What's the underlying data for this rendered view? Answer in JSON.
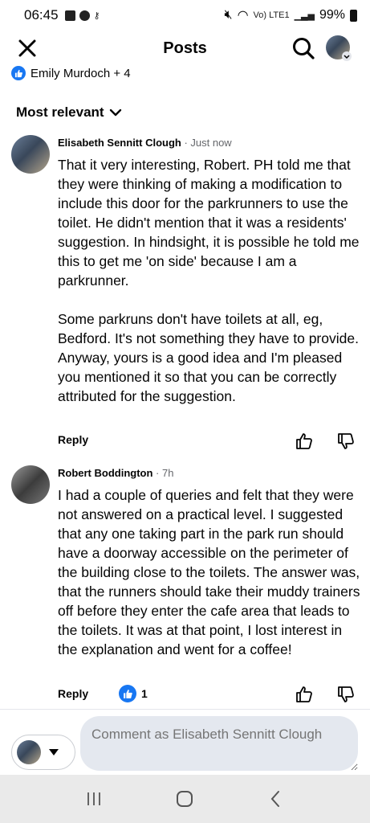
{
  "status_bar": {
    "time": "06:45",
    "net_label": "Vo) LTE1",
    "battery": "99%"
  },
  "header": {
    "title": "Posts"
  },
  "reactors": {
    "text": "Emily Murdoch + 4"
  },
  "sort": {
    "label": "Most relevant"
  },
  "comments": [
    {
      "author": "Elisabeth Sennitt Clough",
      "time": " · Just now",
      "body": "That it very interesting, Robert. PH told me that they were thinking of making a modification to include this door for the parkrunners to use the toilet. He didn't mention that it was a residents' suggestion. In hindsight, it is possible he told me this to get me 'on side' because I am a parkrunner.\n\nSome parkruns don't have toilets at all, eg, Bedford. It's not something they have to provide. Anyway, yours is a good idea and I'm pleased you mentioned it so that you can be correctly attributed for the suggestion.",
      "reply_label": "Reply"
    },
    {
      "author": "Robert Boddington",
      "time": " · 7h",
      "body": "I had a couple of queries and felt that they were not answered on a practical level. I suggested that any one taking part in the park run should have a doorway accessible on the perimeter of the building close to the toilets. The answer was, that the runners should take their muddy trainers off before they enter the cafe area that leads to the toilets. It was at that point, I lost interest in the explanation and went for a coffee!",
      "reply_label": "Reply",
      "reaction_count": "1"
    }
  ],
  "composer": {
    "placeholder": "Comment as Elisabeth Sennitt Clough"
  },
  "colors": {
    "like_blue": "#1877f2",
    "input_bg": "#e4e8ef",
    "nav_bg": "#eaeaea"
  },
  "icons": [
    "close-icon",
    "search-icon",
    "like-icon",
    "chevron-down-icon",
    "thumbs-up-icon",
    "thumbs-down-icon",
    "caret-down-icon",
    "recents-icon",
    "home-icon",
    "back-icon"
  ]
}
